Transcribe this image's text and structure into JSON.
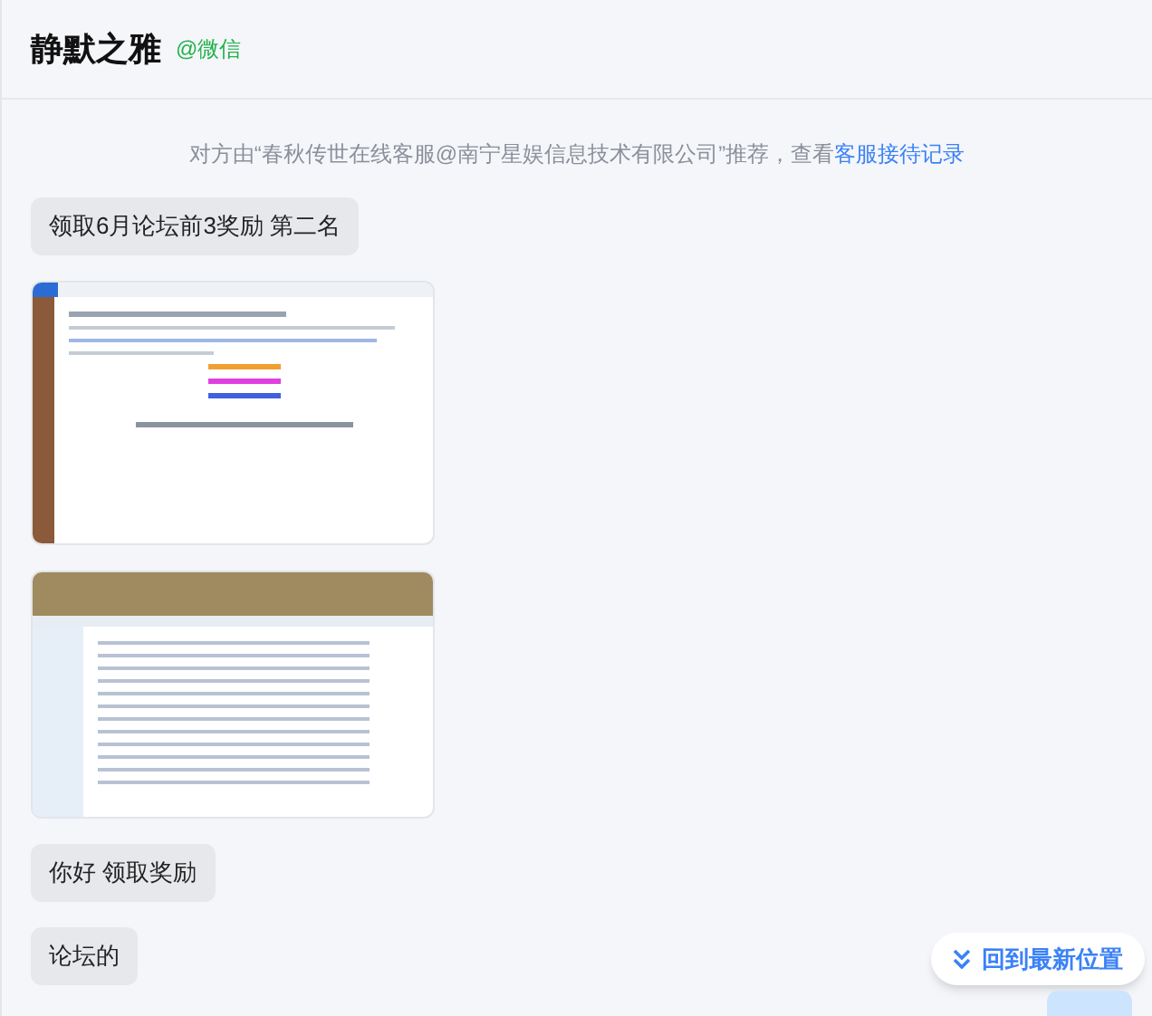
{
  "header": {
    "title": "静默之雅",
    "source": "@微信"
  },
  "notice": {
    "text": "对方由“春秋传世在线客服@南宁星娱信息技术有限公司”推荐，查看",
    "link": "客服接待记录"
  },
  "messages": [
    {
      "kind": "text",
      "text": "领取6月论坛前3奖励 第二名"
    },
    {
      "kind": "email"
    },
    {
      "kind": "forum"
    },
    {
      "kind": "text",
      "text": "你好 领取奖励"
    },
    {
      "kind": "text",
      "text": "论坛的"
    }
  ],
  "jump_button": {
    "label": "回到最新位置"
  }
}
